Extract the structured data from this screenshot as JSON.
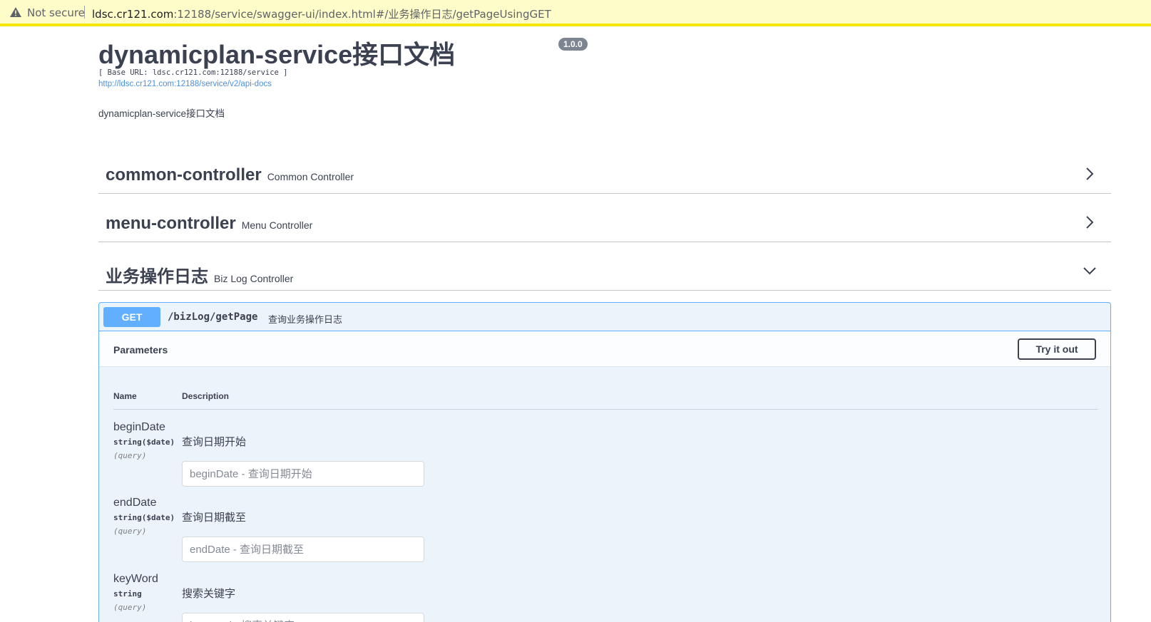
{
  "address_bar": {
    "security_label": "Not secure",
    "host": "ldsc.cr121.com",
    "path": ":12188/service/swagger-ui/index.html#/业务操作日志/getPageUsingGET",
    "icon": "warning-icon"
  },
  "info": {
    "title": "dynamicplan-service接口文档",
    "version": "1.0.0",
    "base_url": "[ Base URL: ldsc.cr121.com:12188/service ]",
    "api_docs_link": "http://ldsc.cr121.com:12188/service/v2/api-docs",
    "description": "dynamicplan-service接口文档"
  },
  "controllers": [
    {
      "name": "common-controller",
      "description": "Common Controller",
      "expanded": false
    },
    {
      "name": "menu-controller",
      "description": "Menu Controller",
      "expanded": false
    },
    {
      "name": "业务操作日志",
      "description": "Biz Log Controller",
      "expanded": true
    }
  ],
  "operation": {
    "method": "GET",
    "path": "/bizLog/getPage",
    "summary": "查询业务操作日志",
    "parameters_title": "Parameters",
    "try_button": "Try it out",
    "columns": {
      "name": "Name",
      "description": "Description"
    },
    "parameters": [
      {
        "name": "beginDate",
        "type": "string($date)",
        "in": "(query)",
        "description": "查询日期开始",
        "placeholder": "beginDate - 查询日期开始"
      },
      {
        "name": "endDate",
        "type": "string($date)",
        "in": "(query)",
        "description": "查询日期截至",
        "placeholder": "endDate - 查询日期截至"
      },
      {
        "name": "keyWord",
        "type": "string",
        "in": "(query)",
        "description": "搜索关键字",
        "placeholder": "keyWord - 搜索关键字"
      }
    ]
  },
  "colors": {
    "get": "#61affe",
    "get_bg": "#ebf3fb",
    "text": "#3b4151",
    "warning_bar": "#fefcc8"
  }
}
